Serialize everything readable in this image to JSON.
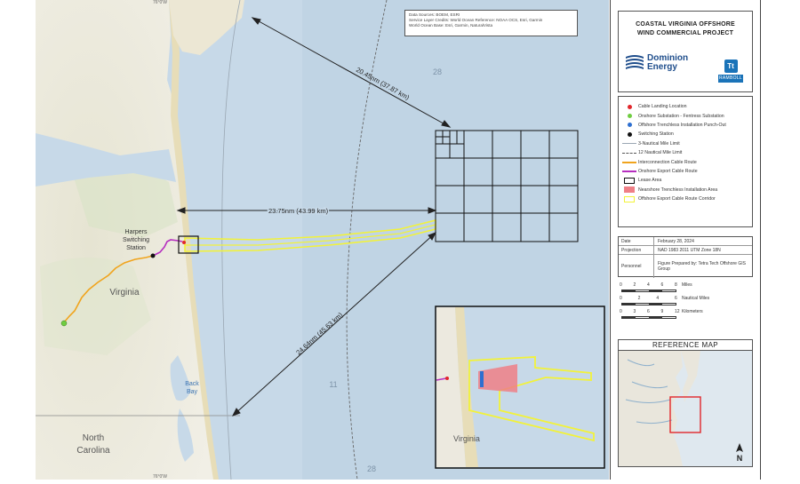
{
  "map": {
    "source_lines": [
      "Data Sources: BOEM, ESRI",
      "Service Layer Credits: World Ocean Reference: NOAA OCS, Esri, Garmin",
      "World Ocean Base: Esri, Garmin, NaturalVista"
    ],
    "place_labels": {
      "harpers_line1": "Harpers",
      "harpers_line2": "Switching",
      "harpers_line3": "Station",
      "virginia": "Virginia",
      "north_line1": "North",
      "north_line2": "Carolina",
      "back_line1": "Back",
      "back_line2": "Bay"
    },
    "depth_labels": {
      "d28_top": "28",
      "d11": "11",
      "d28_bottom": "28"
    },
    "distances": {
      "upper": "20.45nm (37.87 km)",
      "middle": "23.75nm (43.99 km)",
      "lower": "24.64nm (45.63 km)"
    },
    "inset_label": "Virginia",
    "colors": {
      "water": "#c3d6e6",
      "land": "#ece9df",
      "lease": "#111111",
      "corridor": "#f2f23a",
      "export": "#b62fbf",
      "interconnection": "#f0a41d",
      "landing": "#e1262b",
      "substation": "#6fcd41"
    }
  },
  "panel": {
    "title_line1": "COASTAL VIRGINIA OFFSHORE",
    "title_line2": "WIND COMMERCIAL PROJECT",
    "logo_dominion_line1": "Dominion",
    "logo_dominion_line2": "Energy",
    "logo_tt": "Tt",
    "logo_ramboll": "RAMBOLL",
    "legend": [
      {
        "label": "Cable Landing Location",
        "symbol": "dot",
        "color": "#e1262b"
      },
      {
        "label": "Onshore Substation - Fentress Substation",
        "symbol": "dot",
        "color": "#6fcd41"
      },
      {
        "label": "Offshore Trenchless Installation Punch-Out",
        "symbol": "dot",
        "color": "#2e6fd0"
      },
      {
        "label": "Switching Station",
        "symbol": "dot",
        "color": "#111111"
      },
      {
        "label": "3-Nautical Mile Limit",
        "symbol": "thinline",
        "color": "#9aa7b3"
      },
      {
        "label": "12 Nautical Mile Limit",
        "symbol": "dashline",
        "color": "#555555"
      },
      {
        "label": "Interconnection Cable Route",
        "symbol": "line",
        "color": "#f0a41d"
      },
      {
        "label": "Onshore Export Cable Route",
        "symbol": "line",
        "color": "#b62fbf"
      },
      {
        "label": "Lease Area",
        "symbol": "box",
        "color": "#111111"
      },
      {
        "label": "Nearshore Trenchless Installation Area",
        "symbol": "fill",
        "color": "#ef7f86"
      },
      {
        "label": "Offshore Export Cable Route Corridor",
        "symbol": "outline",
        "color": "#f2f23a"
      }
    ],
    "meta": [
      {
        "k": "Date",
        "v": "February 28, 2024"
      },
      {
        "k": "Projection",
        "v": "NAD 1983 2011 UTM Zone 18N"
      },
      {
        "k": "Personnel",
        "v": "Figure Prepared by: Tetra Tech Offshore GIS Group"
      }
    ],
    "scalebars": [
      {
        "ticks": [
          "0",
          "2",
          "4",
          "6",
          "8"
        ],
        "unit": "Miles"
      },
      {
        "ticks": [
          "0",
          "2",
          "4",
          "6"
        ],
        "unit": "Nautical Miles"
      },
      {
        "ticks": [
          "0",
          "3",
          "6",
          "9",
          "12"
        ],
        "unit": "Kilometers"
      }
    ],
    "reference_title": "REFERENCE MAP",
    "north_letter": "N"
  }
}
